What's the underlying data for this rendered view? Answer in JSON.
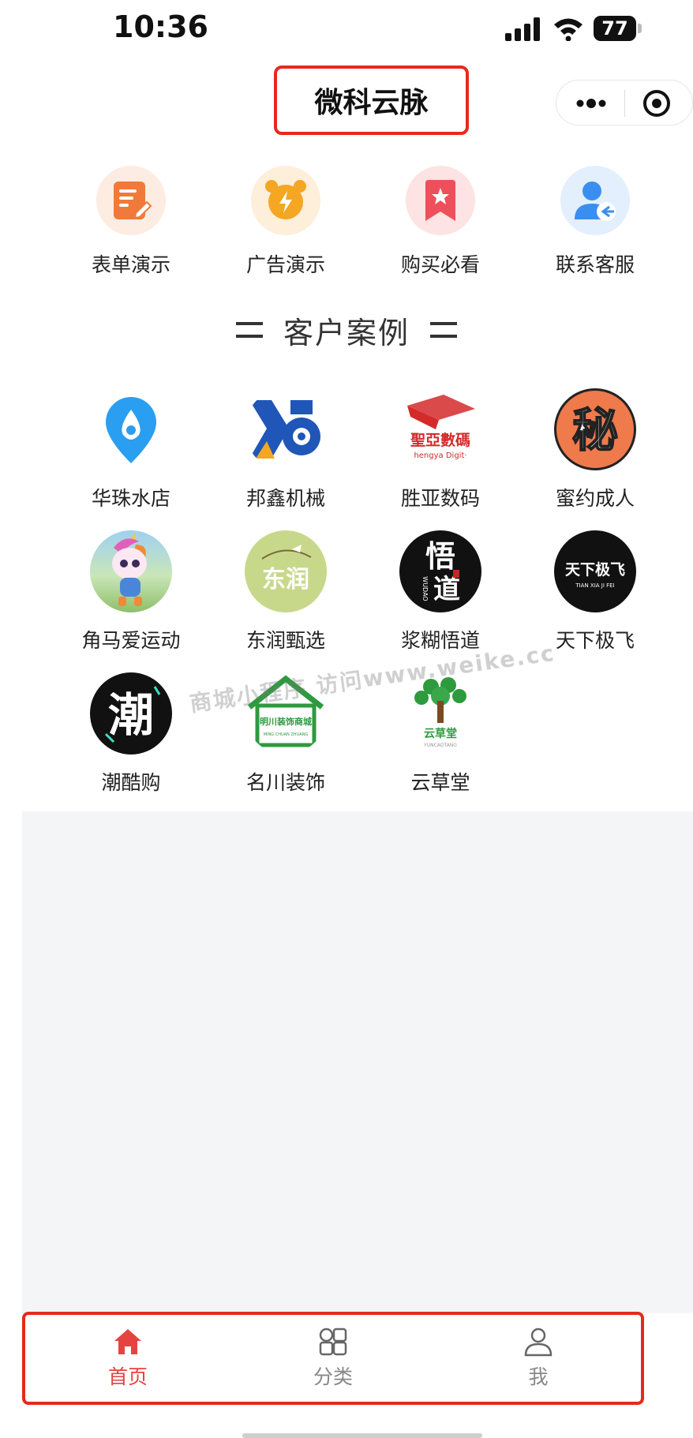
{
  "status_bar": {
    "time": "10:36",
    "battery": "77"
  },
  "nav": {
    "title": "微科云脉"
  },
  "quick_menu": [
    {
      "label": "表单演示",
      "icon": "form-icon",
      "color": "#f07a3a",
      "bg": "#fdece2"
    },
    {
      "label": "广告演示",
      "icon": "alarm-clock-icon",
      "color": "#f5a623",
      "bg": "#fdefd9"
    },
    {
      "label": "购买必看",
      "icon": "bookmark-star-icon",
      "color": "#ef4f5a",
      "bg": "#fde3e3"
    },
    {
      "label": "联系客服",
      "icon": "user-contact-icon",
      "color": "#3a8ef0",
      "bg": "#e3effd"
    }
  ],
  "section": {
    "title": "客户案例"
  },
  "cases": [
    {
      "label": "华珠水店",
      "icon": "water-drop-icon"
    },
    {
      "label": "邦鑫机械",
      "icon": "gear-logo-icon"
    },
    {
      "label": "胜亚数码",
      "icon": "digital-logo-icon",
      "logo_text": "聖亞數碼",
      "logo_sub": "hengya Digit·"
    },
    {
      "label": "蜜约成人",
      "icon": "mi-logo-icon",
      "logo_text": "秘"
    },
    {
      "label": "角马爱运动",
      "icon": "unicorn-avatar-icon"
    },
    {
      "label": "东润甄选",
      "icon": "dongrun-logo-icon",
      "logo_text": "东润"
    },
    {
      "label": "浆糊悟道",
      "icon": "wudao-logo-icon",
      "logo_text": "悟",
      "logo_text2": "道",
      "logo_sub": "WUDAO"
    },
    {
      "label": "天下极飞",
      "icon": "tianxia-logo-icon",
      "logo_text": "天下极飞",
      "logo_sub": "TIAN XIA JI FEI"
    },
    {
      "label": "潮酷购",
      "icon": "chao-logo-icon",
      "logo_text": "潮"
    },
    {
      "label": "名川装饰",
      "icon": "house-logo-icon",
      "logo_text": "明川装饰商城",
      "logo_sub": "MING CHUAN ZHUANG"
    },
    {
      "label": "云草堂",
      "icon": "tree-logo-icon",
      "logo_text": "云草堂",
      "logo_sub": "YUNCAOTANG"
    }
  ],
  "watermark": "商城小程序 访问www.weike.cc",
  "tab_bar": [
    {
      "label": "首页",
      "icon": "home-icon",
      "active": true
    },
    {
      "label": "分类",
      "icon": "category-grid-icon",
      "active": false
    },
    {
      "label": "我",
      "icon": "user-icon",
      "active": false
    }
  ],
  "colors": {
    "accent": "#e64340",
    "highlight_border": "#e8281e",
    "content_bg": "#f4f5f7"
  }
}
